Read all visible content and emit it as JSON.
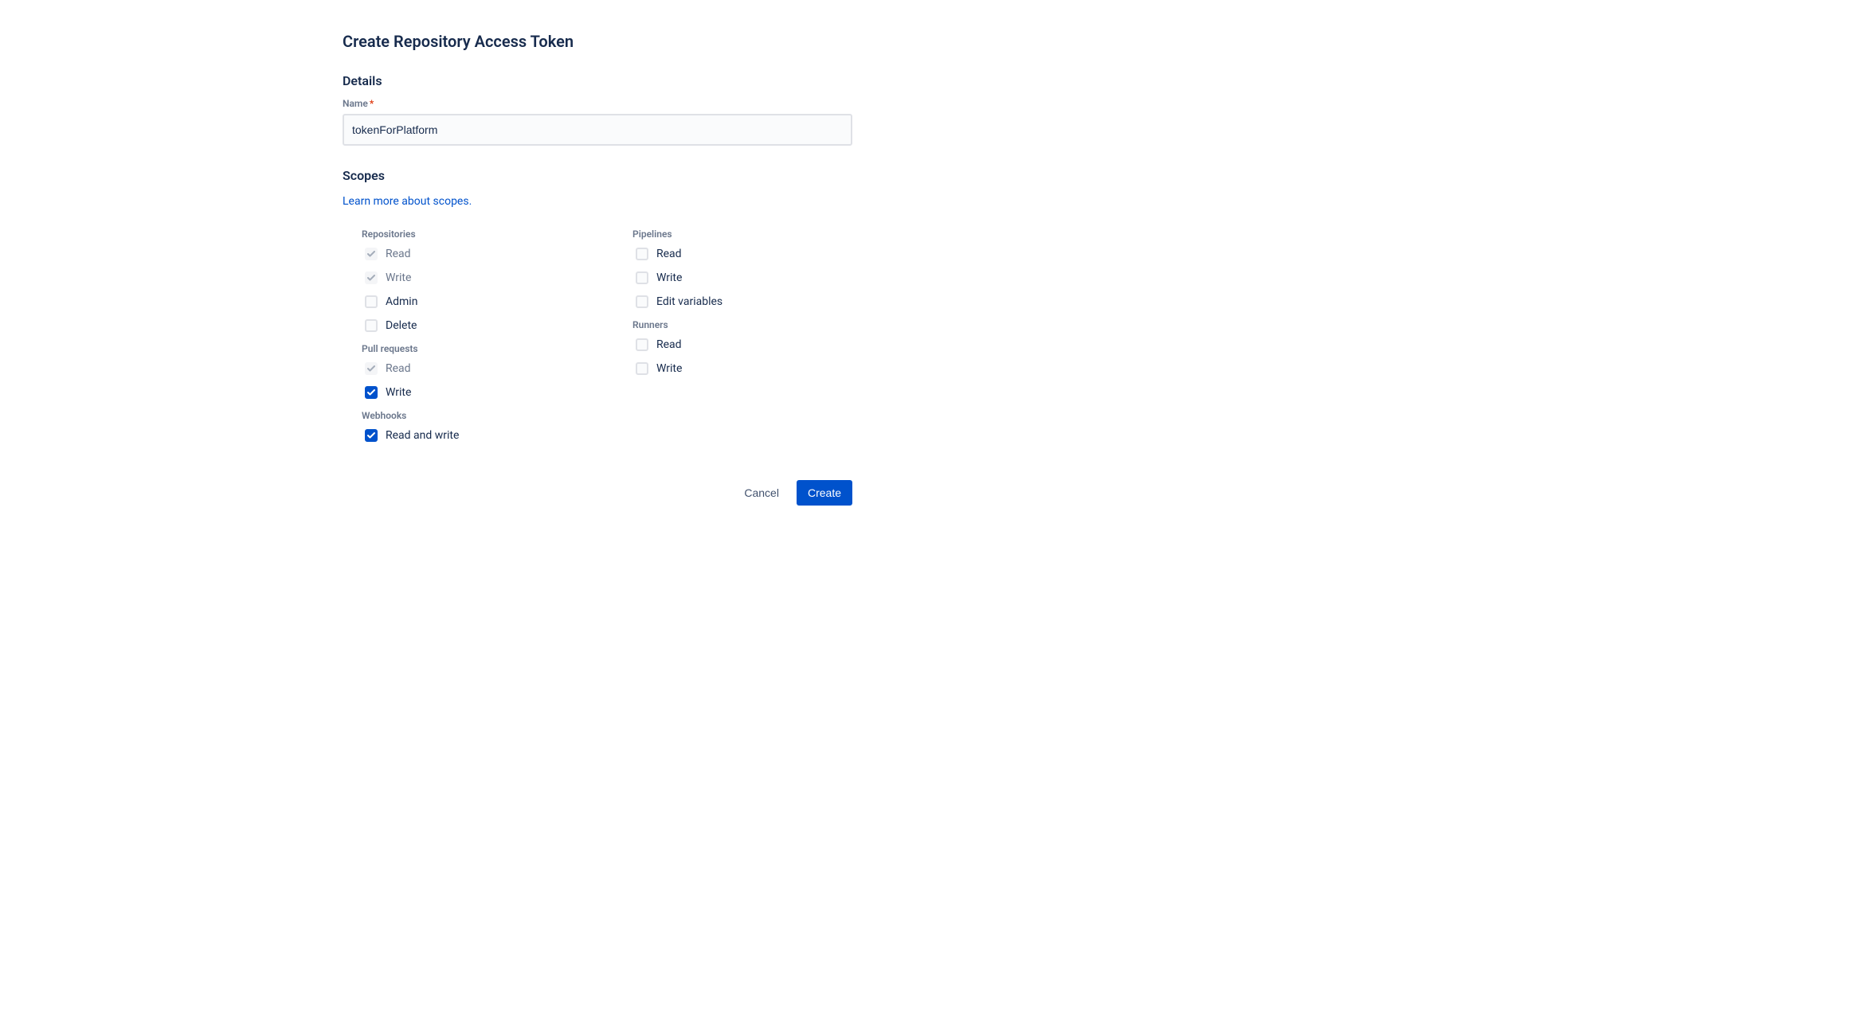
{
  "title": "Create Repository Access Token",
  "details": {
    "section_label": "Details",
    "name_label": "Name",
    "name_value": "tokenForPlatform"
  },
  "scopes": {
    "section_label": "Scopes",
    "link_text": "Learn more about scopes.",
    "groups": {
      "repositories": {
        "label": "Repositories",
        "read": "Read",
        "write": "Write",
        "admin": "Admin",
        "delete": "Delete"
      },
      "pull_requests": {
        "label": "Pull requests",
        "read": "Read",
        "write": "Write"
      },
      "webhooks": {
        "label": "Webhooks",
        "read_write": "Read and write"
      },
      "pipelines": {
        "label": "Pipelines",
        "read": "Read",
        "write": "Write",
        "edit_vars": "Edit variables"
      },
      "runners": {
        "label": "Runners",
        "read": "Read",
        "write": "Write"
      }
    }
  },
  "actions": {
    "cancel": "Cancel",
    "create": "Create"
  }
}
